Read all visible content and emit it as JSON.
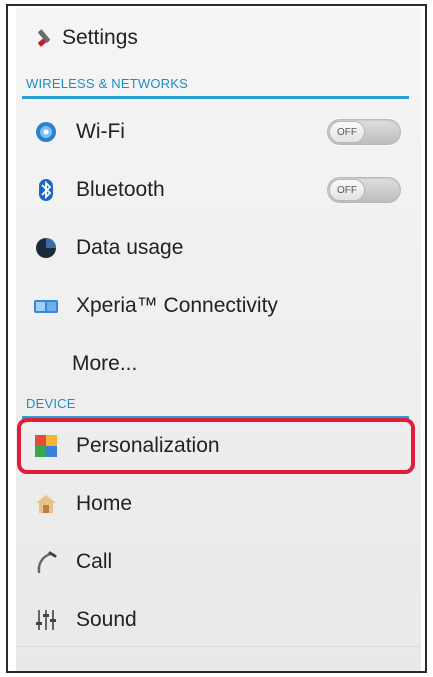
{
  "header": {
    "title": "Settings"
  },
  "sections": [
    {
      "title": "WIRELESS & NETWORKS",
      "items": [
        {
          "label": "Wi-Fi",
          "toggle": "OFF"
        },
        {
          "label": "Bluetooth",
          "toggle": "OFF"
        },
        {
          "label": "Data usage"
        },
        {
          "label": "Xperia™ Connectivity"
        },
        {
          "label": "More..."
        }
      ]
    },
    {
      "title": "DEVICE",
      "items": [
        {
          "label": "Personalization",
          "highlighted": true
        },
        {
          "label": "Home"
        },
        {
          "label": "Call"
        },
        {
          "label": "Sound"
        }
      ]
    }
  ],
  "colors": {
    "accent": "#29a0d2",
    "highlight": "#e01e3c"
  },
  "icons": [
    "settings-icon",
    "wifi-icon",
    "bluetooth-icon",
    "data-usage-icon",
    "xperia-connectivity-icon",
    "personalization-icon",
    "home-icon",
    "call-icon",
    "sound-icon"
  ]
}
